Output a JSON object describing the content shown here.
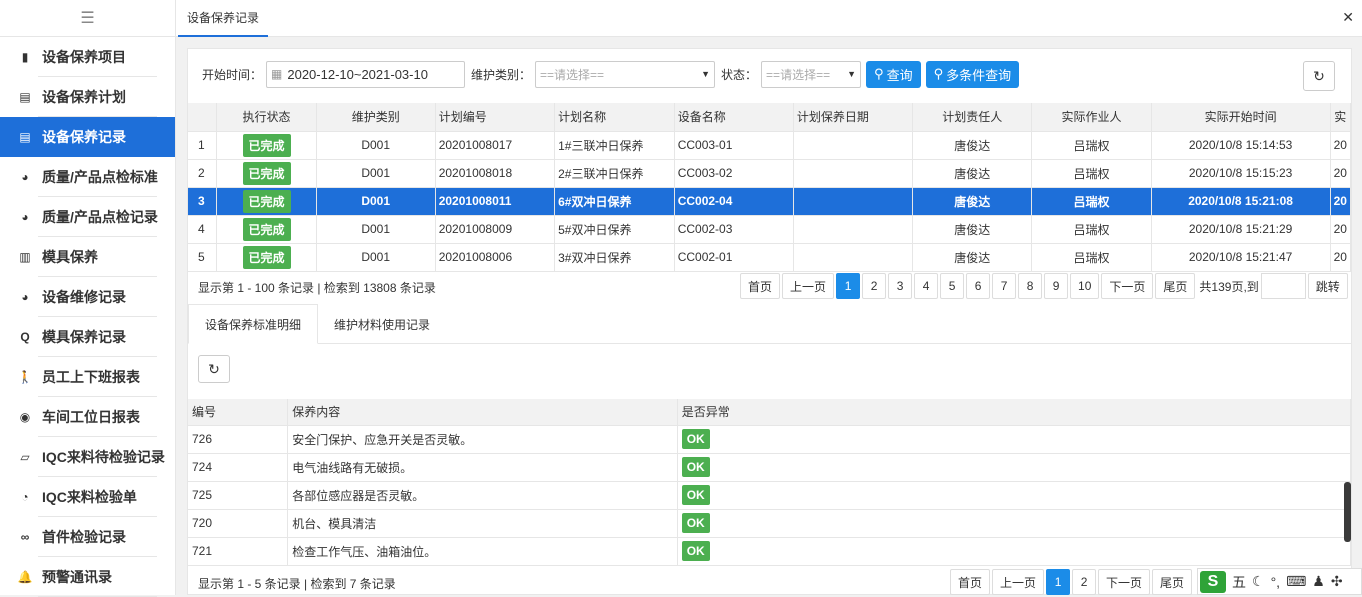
{
  "sidebar": {
    "items": [
      {
        "label": "设备保养项目",
        "icon": "clipboard-icon",
        "glyph": "▮"
      },
      {
        "label": "设备保养计划",
        "icon": "id-card-icon",
        "glyph": "▤"
      },
      {
        "label": "设备保养记录",
        "icon": "id-card-icon",
        "glyph": "▤"
      },
      {
        "label": "质量/产品点检标准",
        "icon": "compass-icon",
        "glyph": "◕"
      },
      {
        "label": "质量/产品点检记录",
        "icon": "compass-icon",
        "glyph": "◕"
      },
      {
        "label": "模具保养",
        "icon": "bar-chart-icon",
        "glyph": "▥"
      },
      {
        "label": "设备维修记录",
        "icon": "compass-icon",
        "glyph": "◕"
      },
      {
        "label": "模具保养记录",
        "icon": "search-icon",
        "glyph": "Q"
      },
      {
        "label": "员工上下班报表",
        "icon": "walking-icon",
        "glyph": "🚶"
      },
      {
        "label": "车间工位日报表",
        "icon": "dot-circle-icon",
        "glyph": "◉"
      },
      {
        "label": "IQC来料待检验记录",
        "icon": "map-icon",
        "glyph": "▱"
      },
      {
        "label": "IQC来料检验单",
        "icon": "dashboard-icon",
        "glyph": "◔"
      },
      {
        "label": "首件检验记录",
        "icon": "handshake-icon",
        "glyph": "∞"
      },
      {
        "label": "预警通讯录",
        "icon": "bell-icon",
        "glyph": "🔔"
      }
    ],
    "active_index": 2
  },
  "header": {
    "tab_title": "设备保养记录"
  },
  "filters": {
    "start_label": "开始时间：",
    "date_range": "2020-12-10~2021-03-10",
    "type_label": "维护类别：",
    "type_placeholder": "==请选择==",
    "status_label": "状态：",
    "status_placeholder": "==请选择==",
    "query_btn": "查询",
    "multi_query_btn": "多条件查询"
  },
  "table1": {
    "columns": [
      "",
      "执行状态",
      "维护类别",
      "计划编号",
      "计划名称",
      "设备名称",
      "计划保养日期",
      "计划责任人",
      "实际作业人",
      "实际开始时间",
      "实"
    ],
    "rows": [
      [
        "1",
        "已完成",
        "D001",
        "20201008017",
        "1#三联冲日保养",
        "CC003-01",
        "",
        "唐俊达",
        "吕瑞权",
        "2020/10/8 15:14:53",
        "20"
      ],
      [
        "2",
        "已完成",
        "D001",
        "20201008018",
        "2#三联冲日保养",
        "CC003-02",
        "",
        "唐俊达",
        "吕瑞权",
        "2020/10/8 15:15:23",
        "20"
      ],
      [
        "3",
        "已完成",
        "D001",
        "20201008011",
        "6#双冲日保养",
        "CC002-04",
        "",
        "唐俊达",
        "吕瑞权",
        "2020/10/8 15:21:08",
        "20"
      ],
      [
        "4",
        "已完成",
        "D001",
        "20201008009",
        "5#双冲日保养",
        "CC002-03",
        "",
        "唐俊达",
        "吕瑞权",
        "2020/10/8 15:21:29",
        "20"
      ],
      [
        "5",
        "已完成",
        "D001",
        "20201008006",
        "3#双冲日保养",
        "CC002-01",
        "",
        "唐俊达",
        "吕瑞权",
        "2020/10/8 15:21:47",
        "20"
      ]
    ],
    "selected_row": 2,
    "info": "显示第 1 - 100 条记录 | 检索到 13808 条记录",
    "pager": {
      "first": "首页",
      "prev": "上一页",
      "pages": [
        "1",
        "2",
        "3",
        "4",
        "5",
        "6",
        "7",
        "8",
        "9",
        "10"
      ],
      "current": "1",
      "next": "下一页",
      "last": "尾页",
      "total_text": "共139页,到",
      "jump": "跳转"
    }
  },
  "detail_tabs": [
    "设备保养标准明细",
    "维护材料使用记录"
  ],
  "table2": {
    "columns": [
      "编号",
      "保养内容",
      "是否异常"
    ],
    "rows": [
      [
        "726",
        "安全门保护、应急开关是否灵敏。",
        "OK"
      ],
      [
        "724",
        "电气油线路有无破损。",
        "OK"
      ],
      [
        "725",
        "各部位感应器是否灵敏。",
        "OK"
      ],
      [
        "720",
        "机台、模具清洁",
        "OK"
      ],
      [
        "721",
        "检查工作气压、油箱油位。",
        "OK"
      ]
    ],
    "info": "显示第 1 - 5 条记录 | 检索到 7 条记录",
    "pager": {
      "first": "首页",
      "prev": "上一页",
      "pages": [
        "1",
        "2"
      ],
      "current": "1",
      "next": "下一页",
      "last": "尾页"
    }
  },
  "ime": {
    "logo": "S",
    "label": "五"
  },
  "colors": {
    "accent": "#1e6fd9",
    "button": "#1b8ce8",
    "ok": "#4caf50"
  }
}
